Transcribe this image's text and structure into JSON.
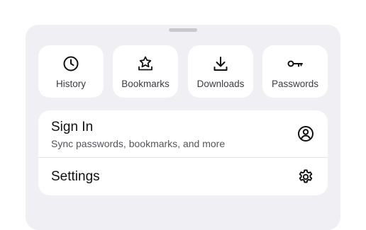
{
  "quick_actions": [
    {
      "label": "History",
      "icon": "clock-icon"
    },
    {
      "label": "Bookmarks",
      "icon": "star-tray-icon"
    },
    {
      "label": "Downloads",
      "icon": "download-icon"
    },
    {
      "label": "Passwords",
      "icon": "key-icon"
    }
  ],
  "account": {
    "title": "Sign In",
    "subtitle": "Sync passwords, bookmarks, and more",
    "icon": "account-icon"
  },
  "settings": {
    "title": "Settings",
    "icon": "gear-icon"
  },
  "colors": {
    "sheet_background": "#f0eff4",
    "card_background": "#ffffff",
    "icon_color": "#111114"
  }
}
